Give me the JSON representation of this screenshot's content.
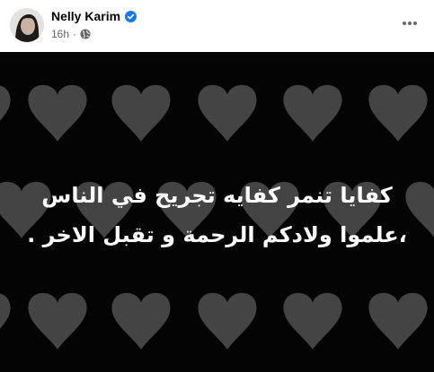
{
  "post": {
    "author": "Nelly Karim",
    "verified": true,
    "timestamp": "16h",
    "separator": "·",
    "audience_icon": "globe-icon",
    "more_icon": "more-options-icon",
    "image_text": {
      "line1": "كفايا تنمر كفايه تجريح في الناس",
      "line2": "،علموا ولادكم الرحمة و تقبل الاخر ."
    }
  },
  "colors": {
    "verified_badge": "#1877f2",
    "image_background": "#040404",
    "heart": "#444444",
    "text_primary": "#050505",
    "text_secondary": "#65676b"
  }
}
